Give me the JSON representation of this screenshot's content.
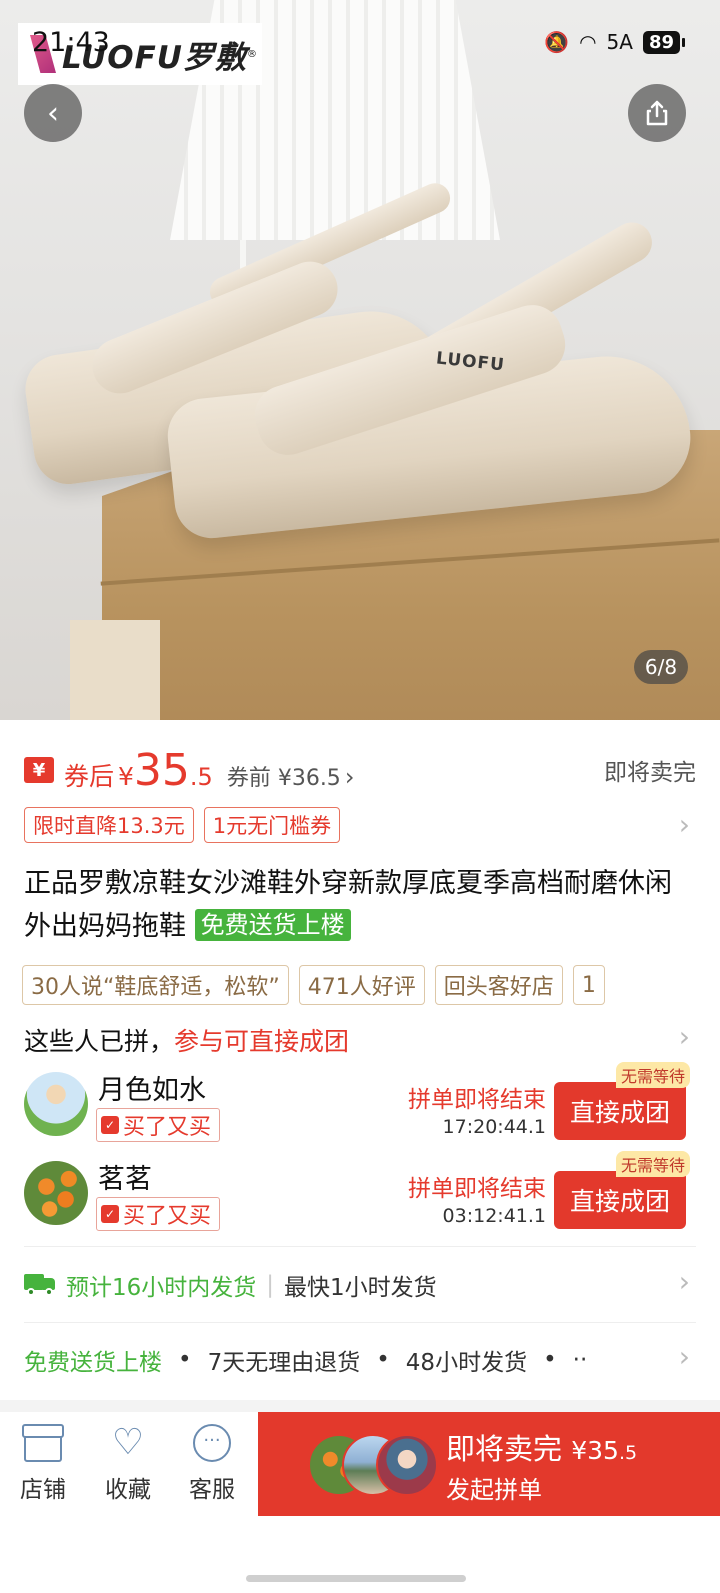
{
  "status_bar": {
    "time": "21:43",
    "network": "5A",
    "battery": "89"
  },
  "brand": {
    "name": "LUOFU罗敷",
    "reg": "®"
  },
  "product_image": {
    "shoe_brand": "LUOFU",
    "counter": "6/8"
  },
  "price": {
    "coupon_icon": "¥",
    "after_label": "券后",
    "currency": "¥",
    "integer": "35",
    "decimal": ".5",
    "before_price": "券前 ¥36.5",
    "status": "即将卖完"
  },
  "promos": [
    "限时直降13.3元",
    "1元无门槛券"
  ],
  "title": {
    "text": "正品罗敷凉鞋女沙滩鞋外穿新款厚底夏季高档耐磨休闲外出妈妈拖鞋",
    "tag": "免费送货上楼"
  },
  "review_tags": [
    "30人说“鞋底舒适，松软”",
    "471人好评",
    "回头客好店",
    "1"
  ],
  "group": {
    "heading": "这些人已拼，",
    "heading_link": "参与可直接成团",
    "members": [
      {
        "name": "月色如水",
        "badge": "买了又买",
        "ending": "拼单即将结束",
        "timer": "17:20:44.1",
        "button": "直接成团",
        "tag": "无需等待"
      },
      {
        "name": "茗茗",
        "badge": "买了又买",
        "ending": "拼单即将结束",
        "timer": "03:12:41.1",
        "button": "直接成团",
        "tag": "无需等待"
      }
    ]
  },
  "shipping": {
    "estimate": "预计16小时内发货",
    "fastest": "最快1小时发货"
  },
  "services": {
    "free_delivery": "免费送货上楼",
    "return": "7天无理由退货",
    "ship48": "48小时发货",
    "more": "··"
  },
  "bottom_bar": {
    "shop": "店铺",
    "favorite": "收藏",
    "service": "客服",
    "buy_main": "即将卖完",
    "buy_price_yen": "¥35",
    "buy_price_dec": ".5",
    "buy_sub": "发起拼单"
  },
  "colors": {
    "accent": "#e3392c",
    "green": "#46b33d",
    "tag_brown": "#8a6b45"
  },
  "icons": [
    "back-arrow-icon",
    "share-icon",
    "coupon-icon",
    "truck-icon",
    "shop-icon",
    "heart-icon",
    "chat-icon"
  ]
}
